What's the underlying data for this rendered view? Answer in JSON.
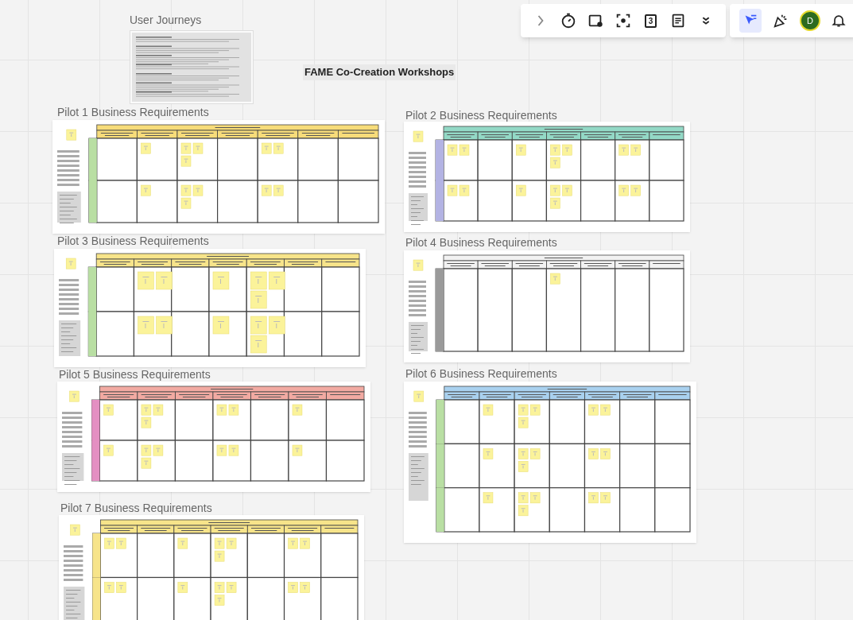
{
  "board": {
    "title": "FAME Co-Creation Workshops"
  },
  "user_journeys": {
    "title": "User Journeys"
  },
  "frames": [
    {
      "title": "Pilot 1 Business Requirements",
      "color": "#f7dc7a",
      "lanes": [
        {
          "color": "#b9dfa3"
        },
        {
          "color": "#b9dfa3"
        }
      ]
    },
    {
      "title": "Pilot 2 Business Requirements",
      "color": "#93d9c6",
      "lanes": [
        {
          "color": "#b3b3e3"
        },
        {
          "color": "#b3b3e3"
        }
      ]
    },
    {
      "title": "Pilot 3 Business Requirements",
      "color": "#f7e48a",
      "lanes": [
        {
          "color": "#b9dfa3"
        },
        {
          "color": "#b9dfa3"
        }
      ]
    },
    {
      "title": "Pilot 4 Business Requirements",
      "color": "#f2f2f2",
      "lanes": [
        {
          "color": "#9a9a9a"
        }
      ]
    },
    {
      "title": "Pilot 5 Business Requirements",
      "color": "#f2aaa2",
      "lanes": [
        {
          "color": "#e48fc2"
        },
        {
          "color": "#e48fc2"
        }
      ]
    },
    {
      "title": "Pilot 6 Business Requirements",
      "color": "#a9d1ef",
      "lanes": [
        {
          "color": "#b9dfa3"
        },
        {
          "color": "#b9dfa3"
        },
        {
          "color": "#b9dfa3"
        }
      ]
    },
    {
      "title": "Pilot 7 Business Requirements",
      "color": "#f7e48a",
      "lanes": [
        {
          "color": "#f7e48a"
        },
        {
          "color": "#f7e48a"
        }
      ]
    }
  ],
  "toolbar": {
    "tools": [
      {
        "kind": "collapse",
        "selected": false
      },
      {
        "kind": "timer",
        "selected": false
      },
      {
        "kind": "card",
        "selected": false
      },
      {
        "kind": "focus",
        "selected": false
      },
      {
        "kind": "calendar",
        "label": "3",
        "selected": false
      },
      {
        "kind": "notes",
        "selected": false
      },
      {
        "kind": "more",
        "selected": false
      }
    ],
    "actions": [
      {
        "kind": "presenter",
        "selected": true
      },
      {
        "kind": "celebrate",
        "selected": false
      }
    ],
    "avatar": {
      "initial": "D"
    },
    "notifications": {
      "kind": "bell"
    }
  }
}
